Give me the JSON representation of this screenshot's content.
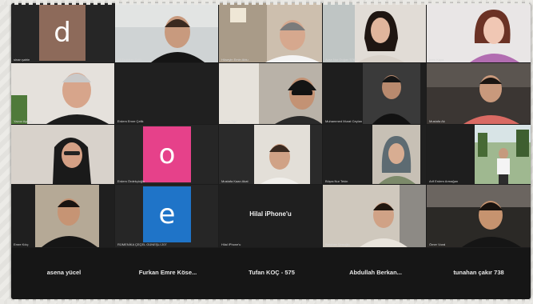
{
  "tiles": [
    {
      "name": "sinan şahin"
    },
    {
      "name": "Ali Emirhan Ünlü"
    },
    {
      "name": "Hüseyin Emin Ablu"
    },
    {
      "name": "Ayşe Nur Doğan 5760"
    },
    {
      "name": "İrem Kaya"
    },
    {
      "name": "Yavuz Açmaz"
    },
    {
      "name": "Erdem Emre Çelik"
    },
    {
      "name": "Kemal Ağır"
    },
    {
      "name": "Muhammed Murat Ceylan"
    },
    {
      "name": "Mustafa Ak"
    },
    {
      "name": "Özlem Gürbüz"
    },
    {
      "name": "Erdem Ördekçioğlu"
    },
    {
      "name": "Mustafa Kaan Akat"
    },
    {
      "name": "Büşra Nur Tekin"
    },
    {
      "name": "Arif Erdem Armağan"
    },
    {
      "name": "Emre Kılıç"
    },
    {
      "name": "RÜMENİKA ÇEÇEL GÜNEŞLİ 207"
    },
    {
      "name": "Hilal iPhone'u"
    },
    {
      "name": "Batuhan Şenoğlu"
    },
    {
      "name": "Ömer Vural"
    }
  ],
  "avatars": {
    "d": "d",
    "o": "o",
    "e": "e"
  },
  "device_label": "Hilal iPhone'u",
  "strip": [
    "asena yücel",
    "Furkan Emre Köse...",
    "Tufan KOÇ - 575",
    "Abdullah Berkan...",
    "tunahan çakır 738"
  ],
  "colors": {
    "avatar_d": "#8d6a5a",
    "avatar_o": "#e6418a",
    "avatar_e": "#1f74c8"
  }
}
